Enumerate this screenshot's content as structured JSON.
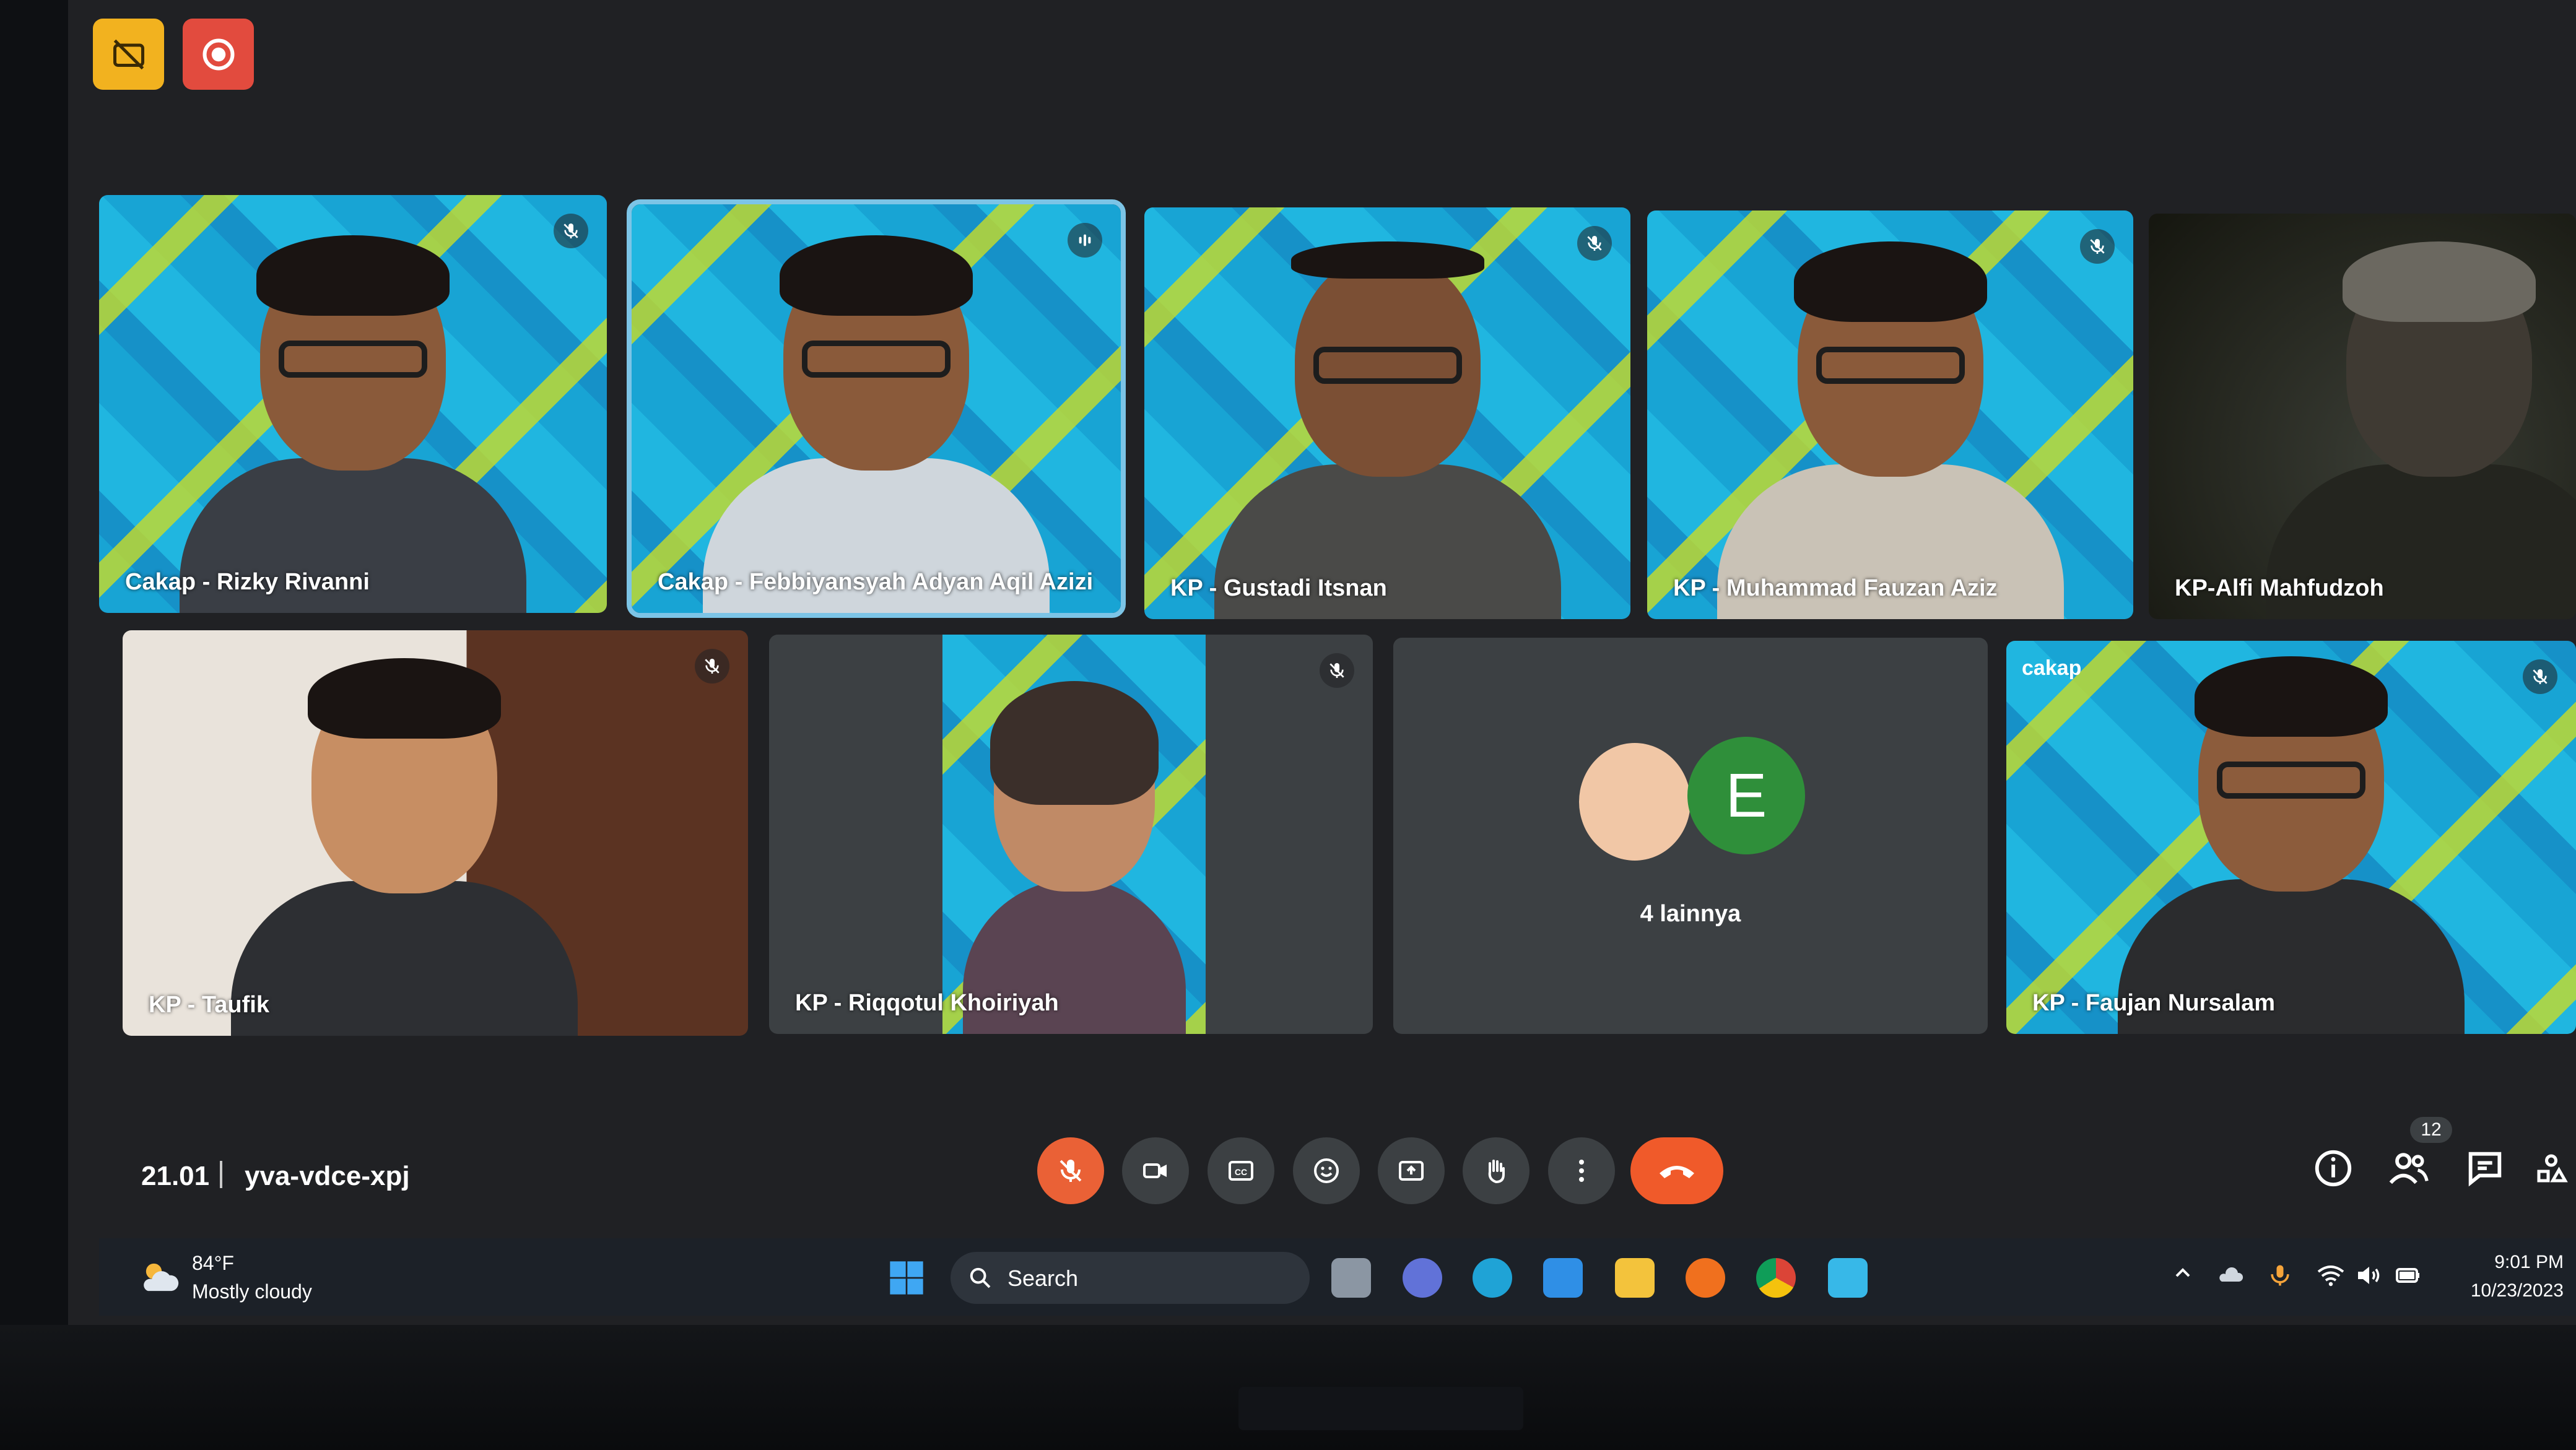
{
  "recording": {
    "indicator_icons": [
      "recording-off-icon",
      "record-icon"
    ]
  },
  "tiles": [
    {
      "name": "Cakap - Rizky Rivanni",
      "muted": true
    },
    {
      "name": "Cakap - Febbiyansyah Adyan Aqil Azizi",
      "speaking": true
    },
    {
      "name": "KP - Gustadi Itsnan",
      "muted": true
    },
    {
      "name": "KP - Muhammad Fauzan Aziz",
      "muted": true
    },
    {
      "name": "KP-Alfi Mahfudzoh"
    },
    {
      "name": "KP - Taufik",
      "muted": true
    },
    {
      "name": "KP - Riqqotul Khoiriyah",
      "muted": true
    },
    {
      "others_label": "4 lainnya",
      "avatar_letter": "E"
    },
    {
      "name": "KP - Faujan Nursalam",
      "muted": true,
      "logo_text": "cakap"
    }
  ],
  "meeting": {
    "time": "21.01",
    "code": "yva-vdce-xpj",
    "people_count": "12"
  },
  "controls": [
    "mic-off-icon",
    "camera-icon",
    "captions-icon",
    "emoji-icon",
    "present-icon",
    "raise-hand-icon",
    "more-options-icon",
    "end-call-icon"
  ],
  "side_controls": [
    "info-icon",
    "people-icon",
    "chat-icon",
    "activities-icon"
  ],
  "taskbar": {
    "weather_temp": "84°F",
    "weather_desc": "Mostly cloudy",
    "search_label": "Search",
    "time": "9:01 PM",
    "date": "10/23/2023"
  },
  "colors": {
    "accent_red": "#ea6136",
    "end_call": "#f05a2a",
    "screen_bg": "#202124",
    "tile_bg": "#3c4043",
    "avatar_green": "#2f8f3a"
  }
}
